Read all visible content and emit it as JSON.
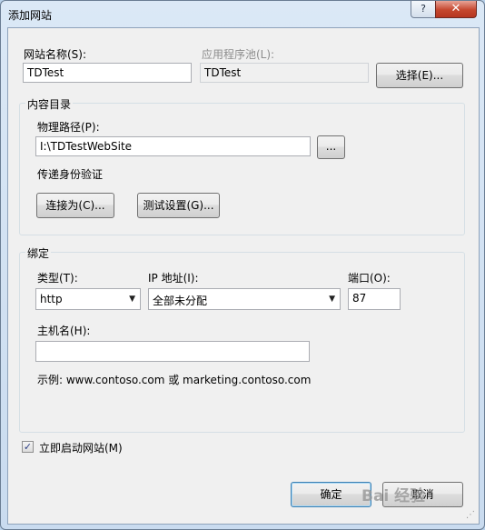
{
  "window": {
    "title": "添加网站",
    "help_label": "?",
    "close_label": "✕"
  },
  "site_name": {
    "label": "网站名称(S):",
    "value": "TDTest"
  },
  "app_pool": {
    "label": "应用程序池(L):",
    "value": "TDTest",
    "select_label": "选择(E)..."
  },
  "content_dir": {
    "group_title": "内容目录",
    "path_label": "物理路径(P):",
    "path_value": "I:\\TDTestWebSite",
    "browse_label": "...",
    "auth_label": "传递身份验证",
    "connect_as_label": "连接为(C)...",
    "test_settings_label": "测试设置(G)..."
  },
  "binding": {
    "group_title": "绑定",
    "type_label": "类型(T):",
    "type_value": "http",
    "ip_label": "IP 地址(I):",
    "ip_value": "全部未分配",
    "port_label": "端口(O):",
    "port_value": "87",
    "host_label": "主机名(H):",
    "host_value": "",
    "example_text": "示例: www.contoso.com 或 marketing.contoso.com"
  },
  "start_now": {
    "label": "立即启动网站(M)",
    "checked": true
  },
  "footer": {
    "ok_label": "确定",
    "cancel_label": "取消"
  },
  "icons": {
    "check": "checkmark-icon",
    "dropdown": "dropdown-arrow-icon",
    "close": "close-icon",
    "help": "help-icon"
  },
  "watermark": "Bai 经验"
}
